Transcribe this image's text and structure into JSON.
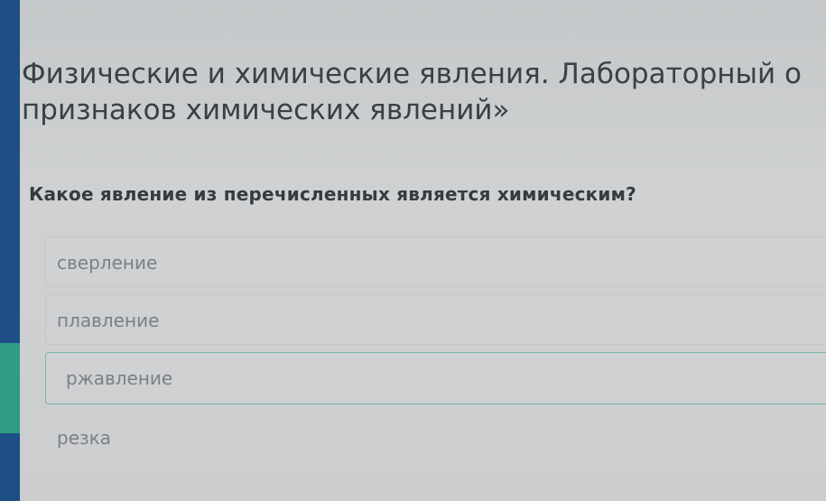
{
  "page": {
    "title_line1": "Физические и химические явления. Лабораторный о",
    "title_line2": "признаков химических явлений»"
  },
  "quiz": {
    "question": "Какое явление из перечисленных является химическим?",
    "options": [
      {
        "label": "сверление",
        "selected": false
      },
      {
        "label": "плавление",
        "selected": false
      },
      {
        "label": "ржавление",
        "selected": true
      },
      {
        "label": "резка",
        "selected": false
      }
    ]
  },
  "colors": {
    "sidebar": "#1d4f86",
    "sidebar_accent": "#2e9c86",
    "selected_border": "#7ab5a8"
  }
}
